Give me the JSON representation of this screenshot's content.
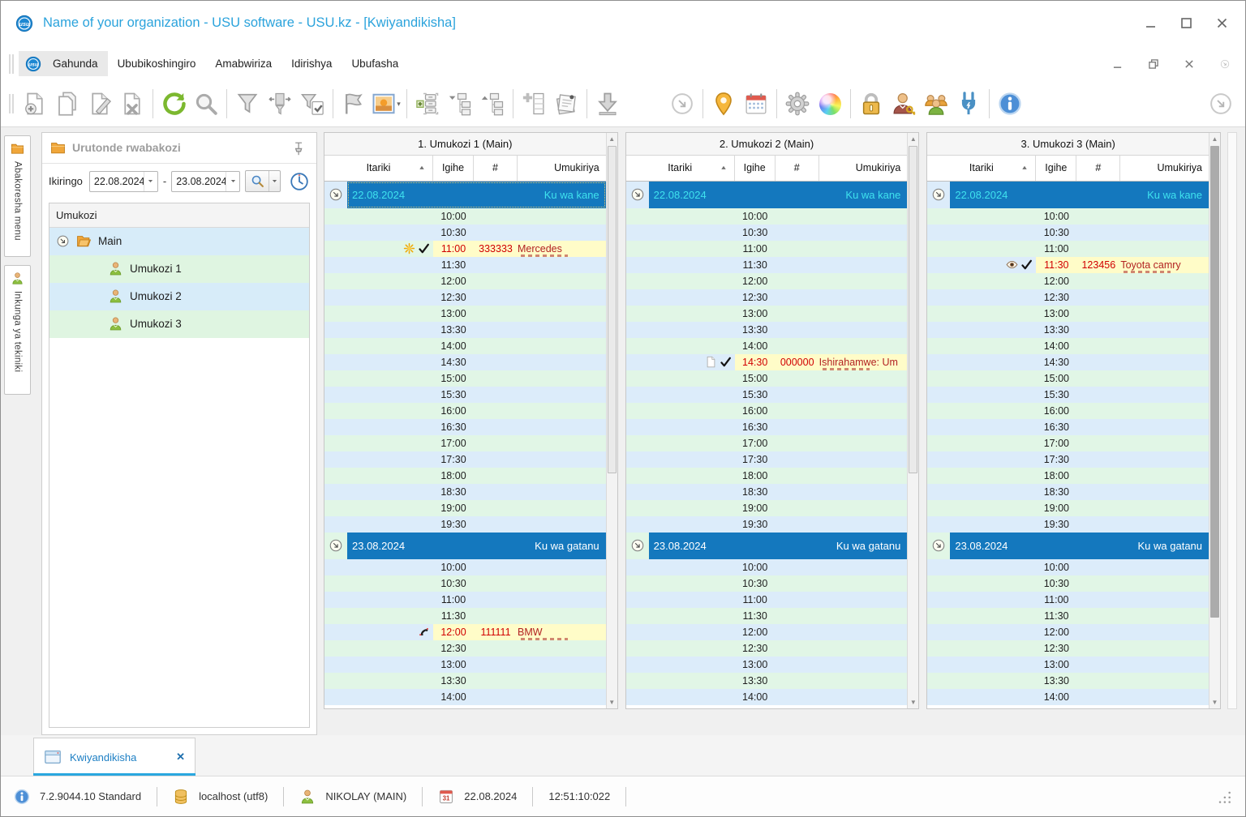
{
  "window": {
    "title": "Name of your organization - USU software - USU.kz - [Kwiyandikisha]"
  },
  "menu": {
    "items": [
      "Gahunda",
      "Ububikoshingiro",
      "Amabwiriza",
      "Idirishya",
      "Ubufasha"
    ],
    "active": "Gahunda"
  },
  "toolbar": {
    "items": [
      "doc-add",
      "doc-copy",
      "doc-edit",
      "doc-delete",
      "sep",
      "refresh",
      "search",
      "sep",
      "filter",
      "filter-shift",
      "filter-check",
      "sep",
      "flag",
      "picture",
      "sep",
      "expand-list",
      "tree-expand",
      "tree-collapse",
      "sep",
      "table-add",
      "notes",
      "sep",
      "download",
      "gap",
      "chevron",
      "sep",
      "map-pin",
      "calendar",
      "sep",
      "gear",
      "palette",
      "sep",
      "lock",
      "user-key",
      "users",
      "plug",
      "sep",
      "info",
      "flex",
      "chevron"
    ]
  },
  "side_tabs": [
    {
      "label": "Abakoresha menu",
      "icon": "folder"
    },
    {
      "label": "Inkunga ya tekiniki",
      "icon": "person"
    }
  ],
  "left_panel": {
    "title": "Urutonde rwabakozi",
    "filter_label": "Ikiringo",
    "date_from": "22.08.2024",
    "date_to": "23.08.2024",
    "range_dash": "-",
    "tree_header": "Umukozi",
    "tree_root": "Main",
    "tree_children": [
      "Umukozi 1",
      "Umukozi 2",
      "Umukozi 3"
    ]
  },
  "schedule": {
    "column_headers": {
      "date": "Itariki",
      "time": "Igihe",
      "number": "#",
      "client": "Umukiriya"
    },
    "days": [
      {
        "date": "22.08.2024",
        "weekday": "Ku wa kane",
        "times": [
          "10:00",
          "10:30",
          "11:00",
          "11:30",
          "12:00",
          "12:30",
          "13:00",
          "13:30",
          "14:00",
          "14:30",
          "15:00",
          "15:30",
          "16:00",
          "16:30",
          "17:00",
          "17:30",
          "18:00",
          "18:30",
          "19:00",
          "19:30"
        ]
      },
      {
        "date": "23.08.2024",
        "weekday": "Ku wa gatanu",
        "times": [
          "10:00",
          "10:30",
          "11:00",
          "11:30",
          "12:00",
          "12:30",
          "13:00",
          "13:30",
          "14:00"
        ]
      }
    ],
    "focused_band": {
      "column": 0,
      "day": 0
    },
    "columns": [
      {
        "title": "1. Umukozi 1 (Main)",
        "entries": [
          {
            "day": 0,
            "time": "11:00",
            "icons": [
              "sun",
              "check"
            ],
            "number": "333333",
            "client": "Mercedes",
            "more": true
          },
          {
            "day": 1,
            "time": "12:00",
            "icons": [
              "phone"
            ],
            "number": "111111",
            "client": "BMW",
            "more": true
          }
        ]
      },
      {
        "title": "2. Umukozi 2 (Main)",
        "entries": [
          {
            "day": 0,
            "time": "14:30",
            "icons": [
              "page",
              "check"
            ],
            "number": "000000",
            "client": "Ishirahamwe: Um",
            "more": true
          }
        ]
      },
      {
        "title": "3. Umukozi 3 (Main)",
        "entries": [
          {
            "day": 0,
            "time": "11:30",
            "icons": [
              "eye",
              "check"
            ],
            "number": "123456",
            "client": "Toyota camry",
            "more": true
          }
        ]
      }
    ]
  },
  "bottom_tab": {
    "label": "Kwiyandikisha",
    "close": "✕"
  },
  "status_bar": {
    "version": "7.2.9044.10 Standard",
    "database": "localhost (utf8)",
    "user": "NIKOLAY (MAIN)",
    "calendar_day": "31",
    "date": "22.08.2024",
    "time": "12:51:10:022"
  },
  "colors": {
    "title_text": "#2ba3dc",
    "band_blue": "#1478be",
    "band_text_first_day": "#3fe2ee",
    "band_text_second_day": "#ffffff",
    "stripe_green": "#e1f6e6",
    "stripe_blue": "#dcecfa",
    "entry_bg": "#fffcc8",
    "entry_text": "#d10000",
    "active_tab_accent": "#2aa7df"
  }
}
